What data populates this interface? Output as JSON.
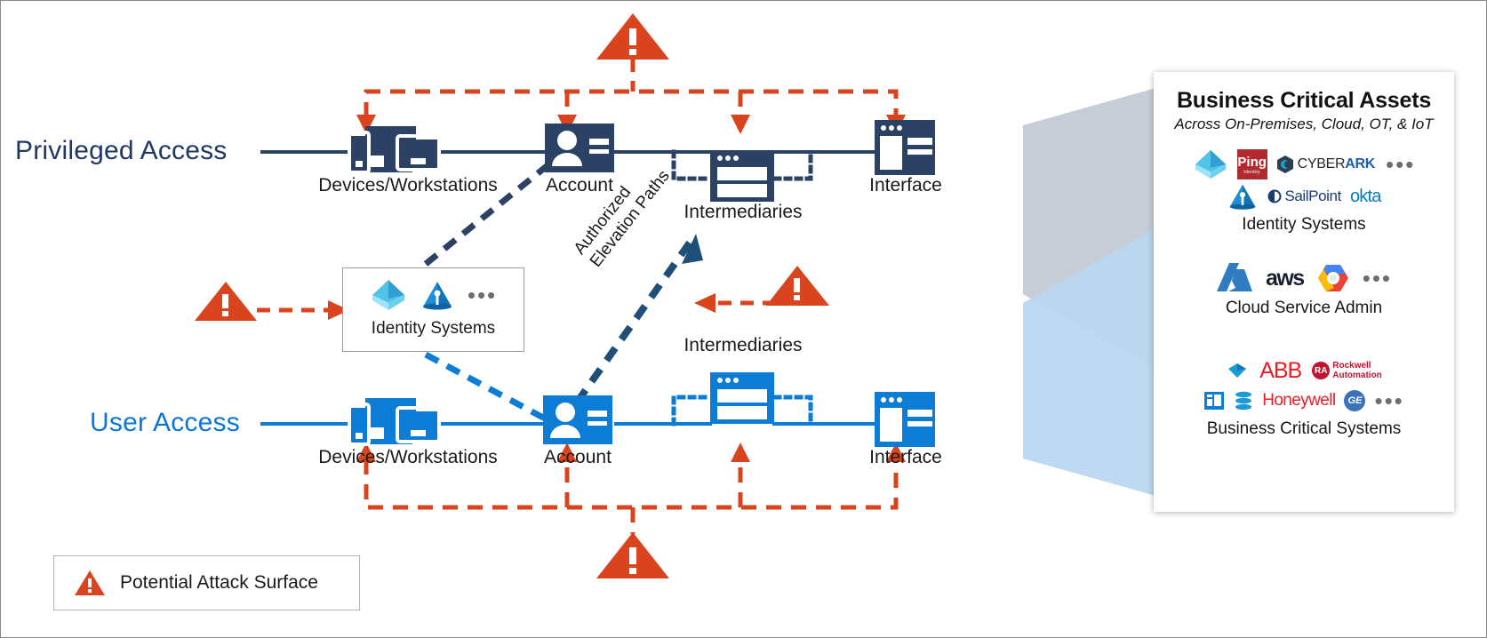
{
  "rows": {
    "privileged": {
      "title": "Privileged Access",
      "color": "#1f3864",
      "nodes": [
        {
          "label": "Devices/Workstations",
          "icon": "devices-icon"
        },
        {
          "label": "Account",
          "icon": "account-icon"
        },
        {
          "label": "Intermediaries",
          "icon": "intermediaries-icon"
        },
        {
          "label": "Interface",
          "icon": "interface-icon"
        }
      ]
    },
    "user": {
      "title": "User Access",
      "color": "#0f76d6",
      "nodes": [
        {
          "label": "Devices/Workstations",
          "icon": "devices-icon"
        },
        {
          "label": "Account",
          "icon": "account-icon"
        },
        {
          "label": "Intermediaries",
          "icon": "intermediaries-icon"
        },
        {
          "label": "Interface",
          "icon": "interface-icon"
        }
      ]
    }
  },
  "identity_box": {
    "caption": "Identity Systems",
    "logos": [
      "azure-ad-logo",
      "active-directory-logo"
    ],
    "more": "•••"
  },
  "elevation": {
    "line1": "Authorized",
    "line2": "Elevation Paths"
  },
  "legend": {
    "label": "Potential Attack Surface",
    "icon": "warning-triangle-icon",
    "color": "#d9431d"
  },
  "card": {
    "title": "Business Critical Assets",
    "subtitle": "Across On-Premises, Cloud, OT, & IoT",
    "groups": [
      {
        "caption": "Identity Systems",
        "row1": [
          "azure-ad-logo",
          "Ping",
          "CYBERARK"
        ],
        "row2": [
          "active-directory-logo",
          "SailPoint",
          "okta"
        ],
        "more": "•••"
      },
      {
        "caption": "Cloud Service Admin",
        "row1": [
          "azure-logo",
          "aws",
          "google-cloud-logo"
        ],
        "row2": [],
        "more": "•••"
      },
      {
        "caption": "Business Critical Systems",
        "row1": [
          "sap-logo",
          "ABB",
          "Rockwell Automation"
        ],
        "row2": [
          "sharepoint-logo",
          "oracle-logo",
          "Honeywell",
          "GE"
        ],
        "more": "•••"
      }
    ]
  },
  "brand_colors": {
    "privileged_navy": "#2b4265",
    "user_blue": "#0c7cd5",
    "attack_orange": "#d9431d",
    "funnel_gray": "#c3cad4",
    "funnel_blue": "#bad7f0"
  }
}
